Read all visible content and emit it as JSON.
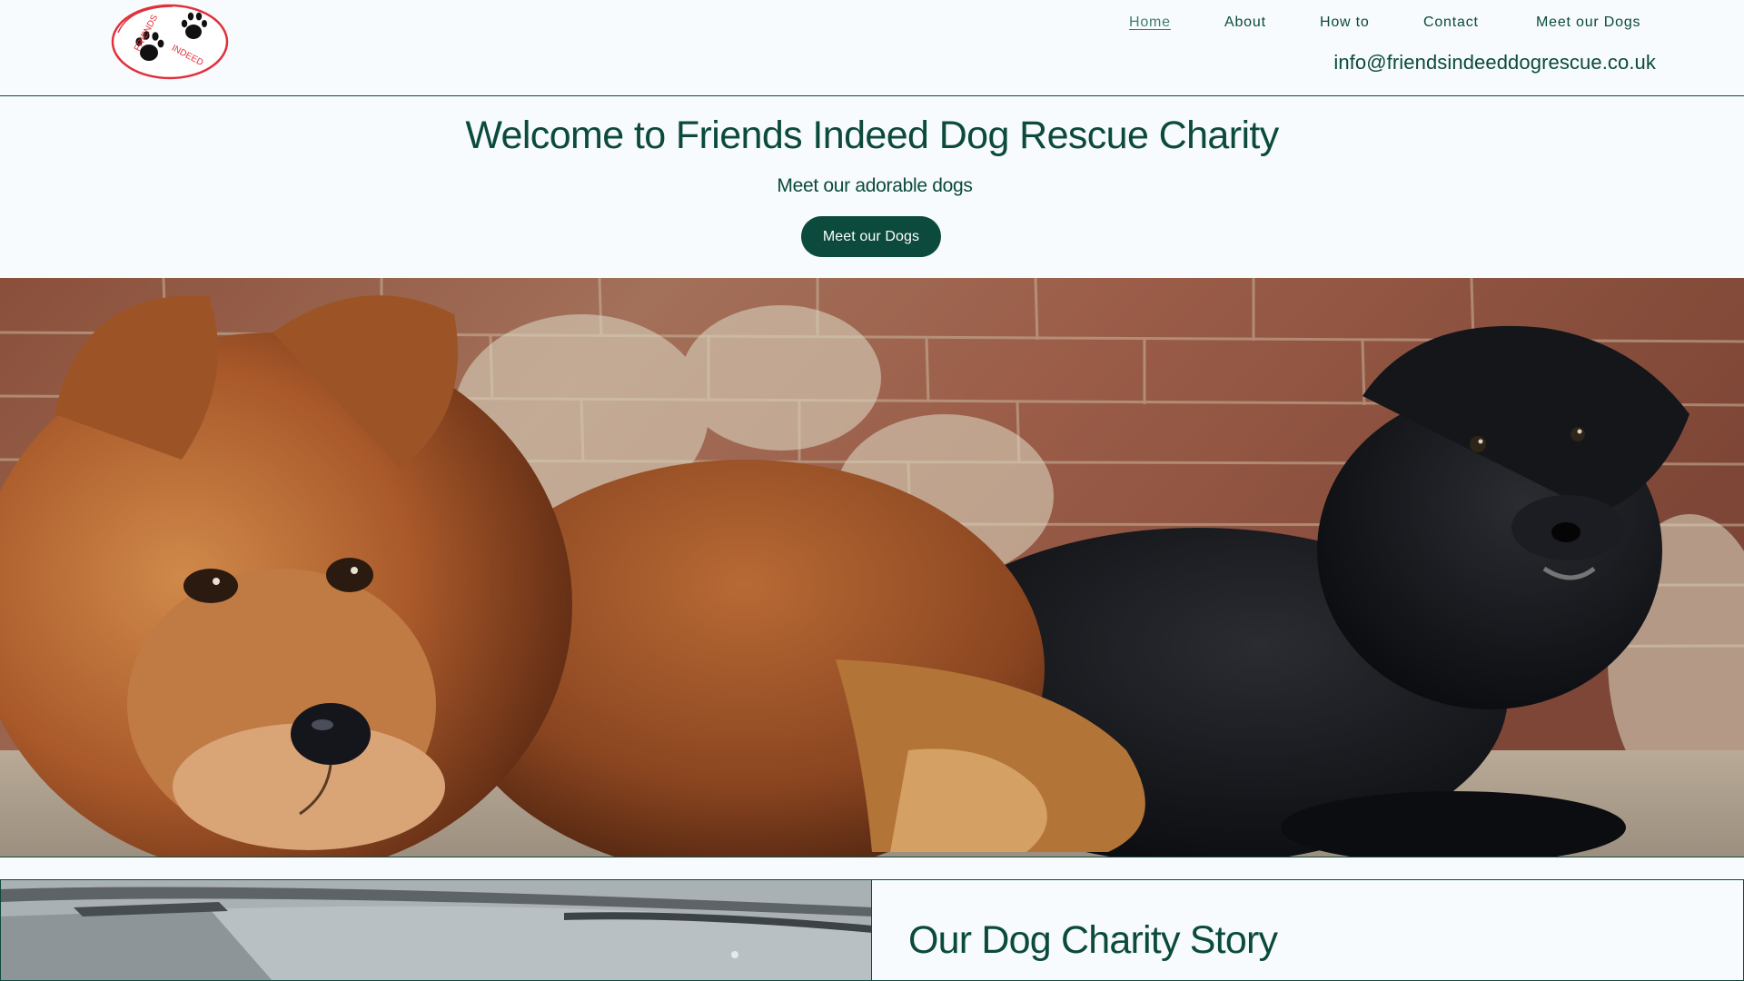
{
  "logo": {
    "text_top": "FRIENDS",
    "text_bottom": "INDEED",
    "accent_color": "#e0303c",
    "icon": "paw-icon"
  },
  "nav": {
    "items": [
      {
        "label": "Home",
        "active": true
      },
      {
        "label": "About",
        "active": false
      },
      {
        "label": "How to",
        "active": false
      },
      {
        "label": "Contact",
        "active": false
      },
      {
        "label": "Meet our Dogs",
        "active": false
      }
    ],
    "email": "info@friendsindeeddogrescue.co.uk"
  },
  "hero": {
    "title": "Welcome to Friends Indeed Dog Rescue Charity",
    "subtitle": "Meet our adorable dogs",
    "button_label": "Meet our Dogs",
    "image_subject": "two rescue dogs, a ginger-brown long-haired dog and a black dog, lying in front of a weathered brick wall"
  },
  "story": {
    "title": "Our Dog Charity Story",
    "subtitle": ""
  },
  "colors": {
    "primary": "#0b4a3c",
    "background": "#f7fbfd",
    "button_text": "#ffffff",
    "logo_red": "#e0303c"
  }
}
